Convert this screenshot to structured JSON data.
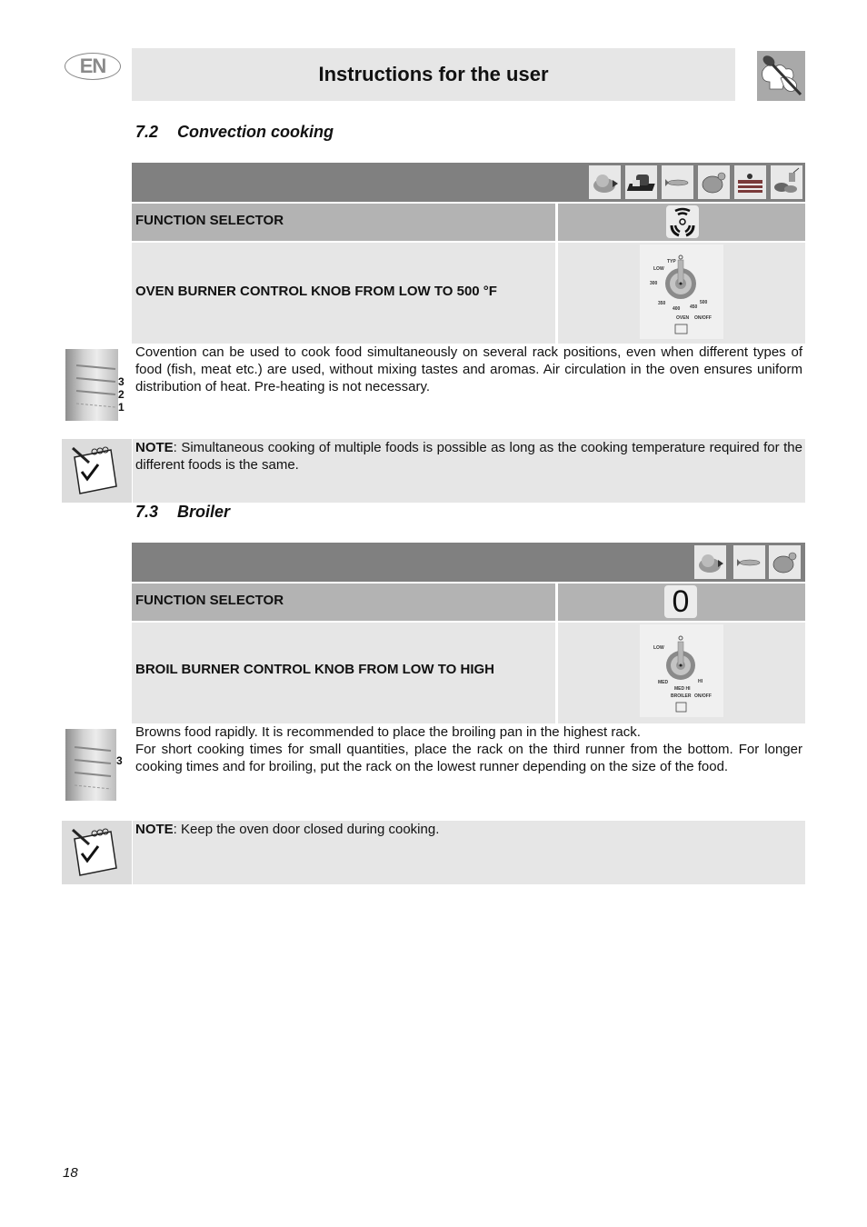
{
  "header": {
    "language_badge": "EN",
    "title": "Instructions for the user",
    "logo_icon": "chef-spoon-icon"
  },
  "sections": [
    {
      "number": "7.2",
      "title": "Convection cooking",
      "food_icons": [
        "roast-meat-icon",
        "bread-icon",
        "fish-icon",
        "poultry-icon",
        "cake-icon",
        "vegetables-icon"
      ],
      "function_selector_label": "FUNCTION SELECTOR",
      "function_selector_icon": "convection-fan-icon",
      "control_label": "OVEN BURNER CONTROL KNOB FROM LOW TO 500 °F",
      "knob_labels": {
        "top": "TYP",
        "low": "LOW",
        "t1": "300",
        "t2": "350",
        "t3": "400",
        "t4": "450",
        "t5": "500",
        "name": "OVEN",
        "onoff": "ON/OFF"
      },
      "rack_positions": [
        "3",
        "2",
        "1"
      ],
      "description": "Covention can be used to cook food simultaneously on several rack positions, even when different types of food (fish, meat etc.) are used, without mixing tastes and aromas. Air circulation in the oven ensures uniform distribution of heat. Pre-heating is not necessary.",
      "note_label": "NOTE",
      "note_text": ": Simultaneous cooking of multiple foods is possible as long as the cooking temperature required for the different foods is the same."
    },
    {
      "number": "7.3",
      "title": "Broiler",
      "food_icons": [
        "roast-meat-icon",
        "fish-icon",
        "poultry-icon"
      ],
      "function_selector_label": "FUNCTION SELECTOR",
      "function_selector_icon": "zero-position-icon",
      "function_selector_glyph": "0",
      "control_label": "BROIL BURNER CONTROL KNOB FROM LOW TO HIGH",
      "knob_labels": {
        "low": "LOW",
        "med": "MED",
        "medhi": "MED HI",
        "hi": "HI",
        "name": "BROILER",
        "onoff": "ON/OFF"
      },
      "rack_positions": [
        "3"
      ],
      "description_1": "Browns food rapidly. It is recommended to place the broiling pan in the highest rack.",
      "description_2": "For short cooking times for small quantities, place the rack on the third runner from the bottom. For longer cooking times and for broiling, put the rack on the lowest runner depending on the size of the food.",
      "note_label": "NOTE",
      "note_text": ": Keep the oven door closed during cooking."
    }
  ],
  "footer": {
    "page_number": "18"
  }
}
